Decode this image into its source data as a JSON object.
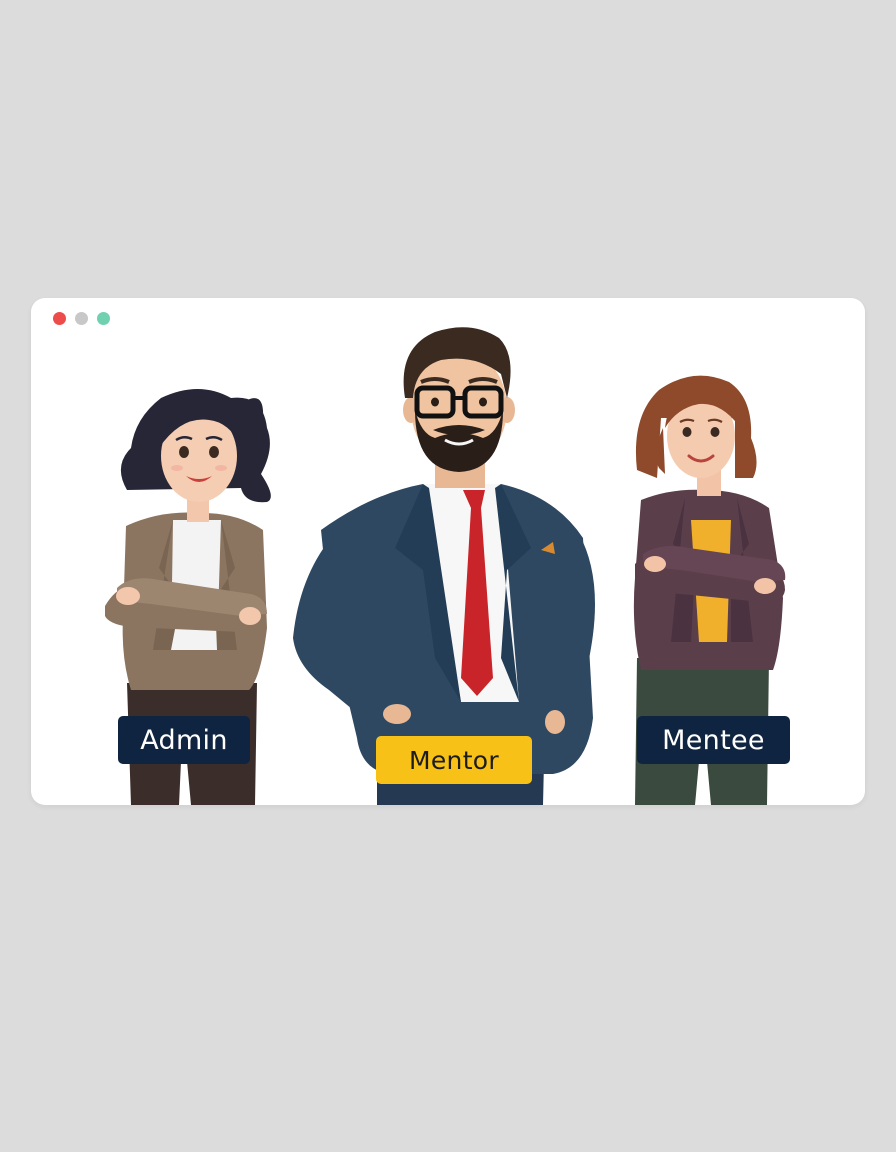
{
  "window": {
    "controls": [
      {
        "name": "close-dot",
        "color": "#ee4b4b"
      },
      {
        "name": "minimize-dot",
        "color": "#c8c8c8"
      },
      {
        "name": "maximize-dot",
        "color": "#6fd1b0"
      }
    ]
  },
  "roles": [
    {
      "id": "admin",
      "label": "Admin",
      "selected": false,
      "button_color": "#0f2440"
    },
    {
      "id": "mentor",
      "label": "Mentor",
      "selected": true,
      "button_color": "#f7c118",
      "text_color": "#1c1c1c"
    },
    {
      "id": "mentee",
      "label": "Mentee",
      "selected": false,
      "button_color": "#0f2440"
    }
  ],
  "colors": {
    "page_background": "#dcdcdc",
    "window_background": "#ffffff"
  }
}
